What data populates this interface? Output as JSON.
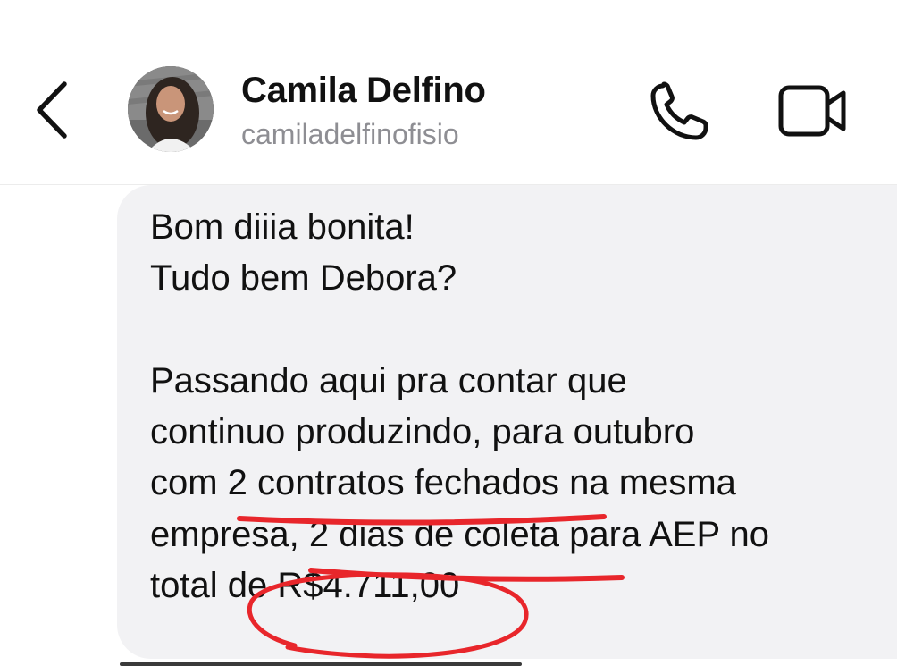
{
  "header": {
    "contact_name": "Camila Delfino",
    "contact_handle": "camiladelfinofisio",
    "back_icon": "chevron-left-icon",
    "call_icon": "phone-icon",
    "video_icon": "video-camera-icon"
  },
  "message": {
    "lines": [
      "Bom diiia bonita!",
      "Tudo bem Debora?",
      "",
      "Passando aqui pra contar que",
      "continuo produzindo, para outubro",
      "com 2 contratos fechados na mesma",
      "empresa, 2 dias de coleta para AEP no",
      "total de R$4.711,00"
    ]
  },
  "colors": {
    "bubble": "#f2f2f4",
    "annotation": "#e8262b",
    "handle": "#8e8e93",
    "text": "#111111"
  }
}
